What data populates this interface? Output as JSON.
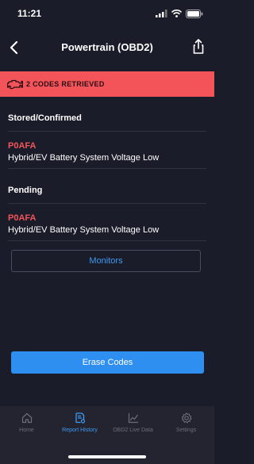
{
  "status_bar": {
    "time": "11:21"
  },
  "header": {
    "title": "Powertrain (OBD2)"
  },
  "banner": {
    "text": "2 CODES RETRIEVED",
    "color": "#f2545a"
  },
  "sections": [
    {
      "title": "Stored/Confirmed",
      "code": "P0AFA",
      "description": "Hybrid/EV Battery System Voltage Low"
    },
    {
      "title": "Pending",
      "code": "P0AFA",
      "description": "Hybrid/EV Battery System Voltage Low"
    }
  ],
  "buttons": {
    "monitors": "Monitors",
    "erase": "Erase Codes"
  },
  "tabs": [
    {
      "label": "Home",
      "icon": "home-icon",
      "active": false
    },
    {
      "label": "Report History",
      "icon": "report-icon",
      "active": true
    },
    {
      "label": "OBD2 Live Data",
      "icon": "chart-icon",
      "active": false
    },
    {
      "label": "Settings",
      "icon": "gear-icon",
      "active": false
    }
  ],
  "colors": {
    "background": "#1b1c2a",
    "accent": "#3f9af2",
    "error": "#f2545a"
  }
}
